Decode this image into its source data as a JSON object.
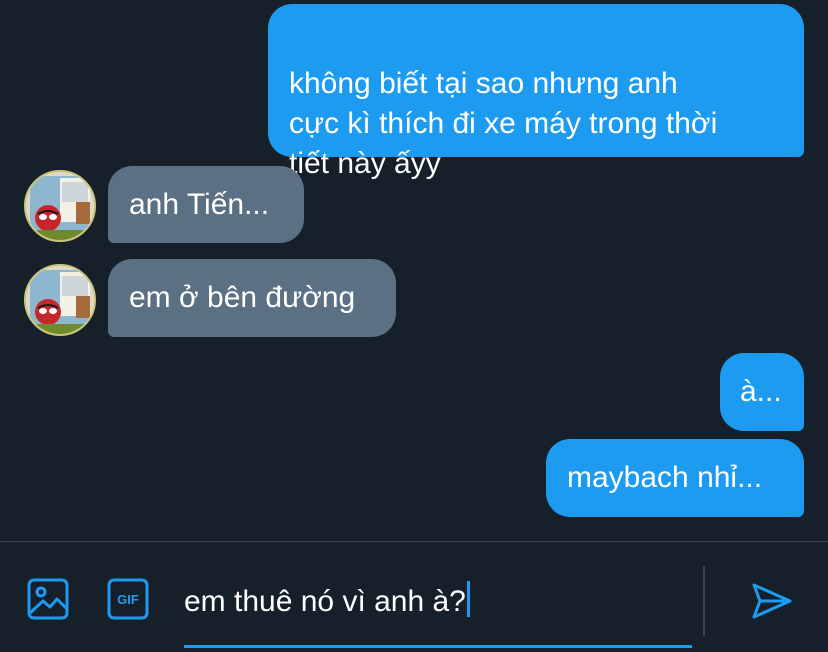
{
  "conversation": {
    "messages": [
      {
        "direction": "sent",
        "text": "không biết tại sao nhưng anh\ncực kì thích đi xe máy trong thời\ntiết này ấyy"
      },
      {
        "direction": "received",
        "text": "anh Tiến..."
      },
      {
        "direction": "received",
        "text": "em ở bên đường"
      },
      {
        "direction": "sent",
        "text": "à..."
      },
      {
        "direction": "sent",
        "text": "maybach nhỉ..."
      }
    ]
  },
  "composer": {
    "input_value": "em thuê nó vì anh à?",
    "gif_label": "GIF",
    "image_icon": "image-icon",
    "gif_icon": "gif-icon",
    "send_icon": "send-icon"
  },
  "colors": {
    "background": "#15202b",
    "sent_bubble": "#1d9bf0",
    "received_bubble": "#5b7083",
    "accent": "#1d9bf0",
    "divider": "#38444d"
  }
}
